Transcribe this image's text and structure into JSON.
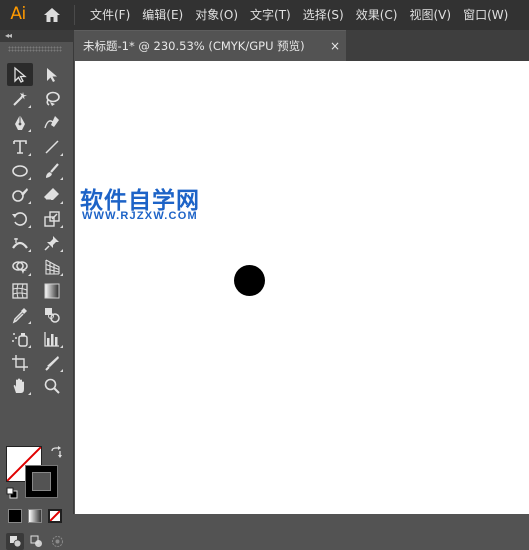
{
  "app": {
    "logo_text": "Ai"
  },
  "menu": {
    "items": [
      "文件(F)",
      "编辑(E)",
      "对象(O)",
      "文字(T)",
      "选择(S)",
      "效果(C)",
      "视图(V)",
      "窗口(W)"
    ]
  },
  "document_tab": {
    "title": "未标题-1* @ 230.53% (CMYK/GPU 预览)",
    "close_glyph": "×"
  },
  "panel": {
    "collapse_glyph": "◂◂"
  },
  "canvas": {
    "watermark_title": "软件自学网",
    "watermark_url": "WWW.RJZXW.COM"
  },
  "colors": {
    "accent_logo": "#ff9a00",
    "watermark": "#1d63c7",
    "menubar_bg": "#323232",
    "panel_bg": "#535353"
  }
}
